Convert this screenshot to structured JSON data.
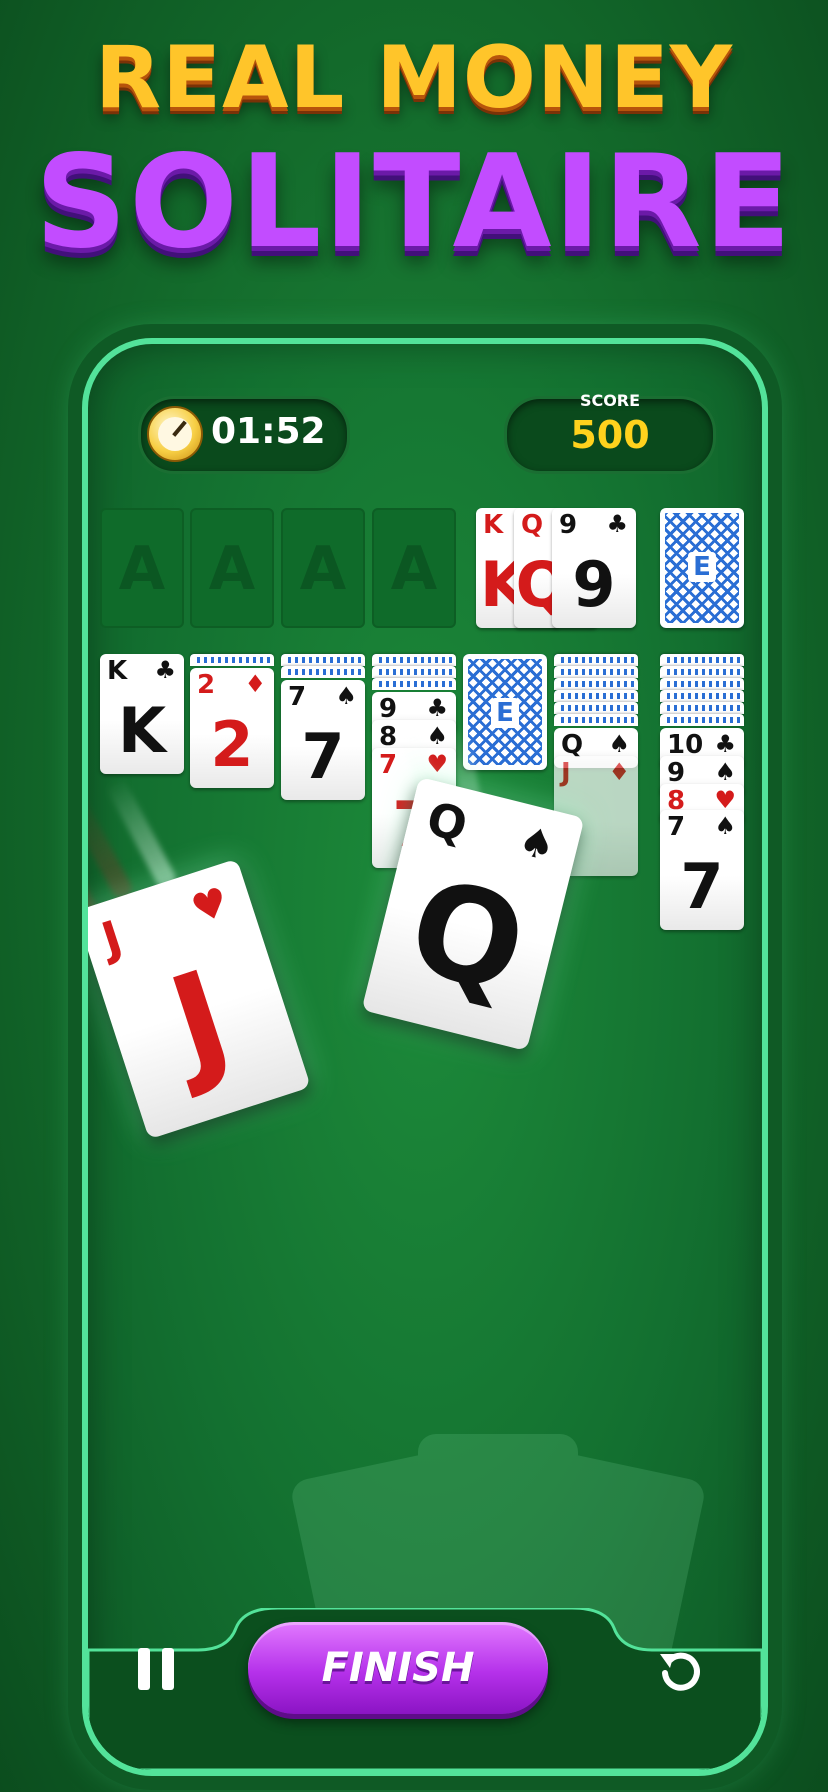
{
  "title": {
    "line1": "REAL MONEY",
    "line2": "SOLITAIRE"
  },
  "hud": {
    "timer": "01:52",
    "score_label": "SCORE",
    "score_value": "500"
  },
  "foundations": [
    "A",
    "A",
    "A",
    "A"
  ],
  "waste": [
    {
      "rank": "K",
      "suit": "♥",
      "color": "red"
    },
    {
      "rank": "Q",
      "suit": "♥",
      "color": "red"
    },
    {
      "rank": "9",
      "suit": "♣",
      "color": "black"
    }
  ],
  "stock": {
    "logo": "E"
  },
  "tableau": [
    {
      "rank": "K",
      "suit": "♣",
      "color": "black"
    },
    {
      "rank": "2",
      "suit": "♦",
      "color": "red"
    },
    {
      "rank": "7",
      "suit": "♠",
      "color": "black"
    },
    {
      "stack": [
        {
          "rank": "9",
          "suit": "♣",
          "color": "black"
        },
        {
          "rank": "8",
          "suit": "♠",
          "color": "black"
        },
        {
          "rank": "7",
          "suit": "♥",
          "color": "red"
        }
      ]
    },
    {
      "face_down": true
    },
    {
      "stack": [
        {
          "rank": "Q",
          "suit": "♠",
          "color": "black"
        },
        {
          "rank": "J",
          "suit": "♦",
          "color": "red"
        }
      ]
    },
    {
      "stack": [
        {
          "rank": "10",
          "suit": "♣",
          "color": "black"
        },
        {
          "rank": "9",
          "suit": "♠",
          "color": "black"
        },
        {
          "rank": "8",
          "suit": "♥",
          "color": "red"
        },
        {
          "rank": "7",
          "suit": "♠",
          "color": "black"
        }
      ]
    }
  ],
  "flying_cards": [
    {
      "rank": "J",
      "suit": "♥",
      "color": "red"
    },
    {
      "rank": "Q",
      "suit": "♠",
      "color": "black"
    }
  ],
  "buttons": {
    "finish": "FINISH"
  },
  "colors": {
    "felt": "#1a7d35",
    "accent": "#53e39a",
    "finish": "#b531ea",
    "score": "#ffd21d"
  }
}
